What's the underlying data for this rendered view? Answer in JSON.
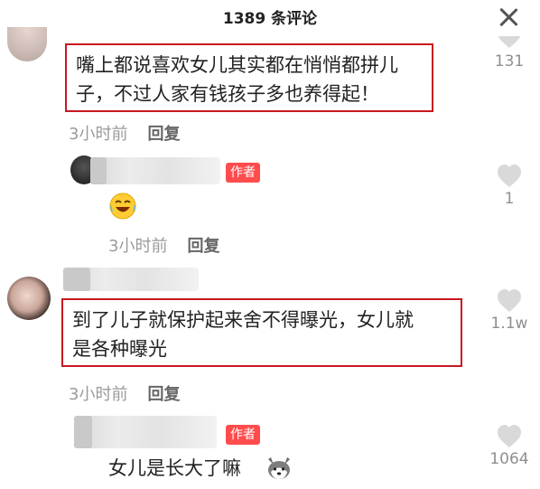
{
  "header": {
    "title": "1389 条评论"
  },
  "comments": [
    {
      "text_line1": "嘴上都说喜欢女儿其实都在悄悄都拼儿",
      "text_line2": "子，不过人家有钱孩子多也养得起！",
      "time": "3小时前",
      "reply_label": "回复",
      "likes": "131"
    },
    {
      "author_badge": "作者",
      "time": "3小时前",
      "reply_label": "回复",
      "likes": "1"
    },
    {
      "text_line1": "到了儿子就保护起来舍不得曝光，女儿就",
      "text_line2": "是各种曝光",
      "time": "3小时前",
      "reply_label": "回复",
      "likes": "1.1w"
    },
    {
      "author_badge": "作者",
      "text": "女儿是长大了嘛",
      "likes": "1064"
    }
  ],
  "icons": {
    "close": "close-icon",
    "heart": "heart-icon",
    "laugh_emoji": "laughing-tears-emoji",
    "dog_emoji": "husky-dog-emoji"
  },
  "colors": {
    "highlight_border": "#c8181e",
    "author_badge_bg": "#ff4c4c",
    "heart": "#d9d9d9"
  }
}
